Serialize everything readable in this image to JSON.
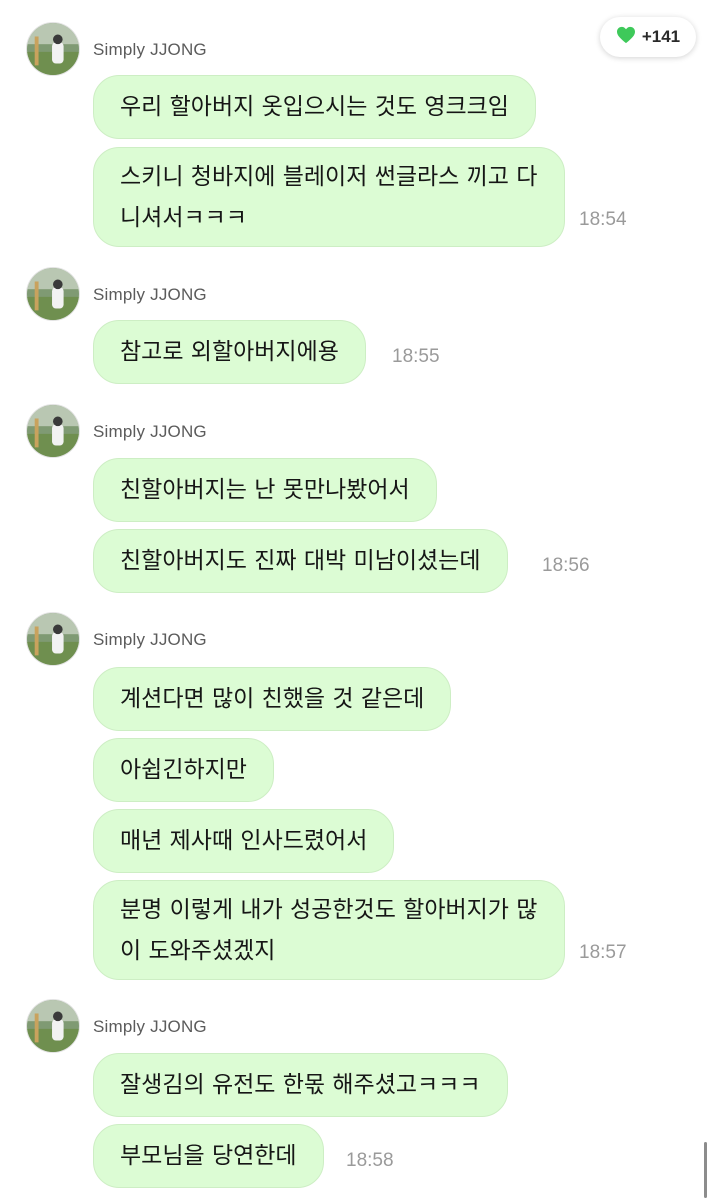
{
  "colors": {
    "bubble": "#dcfcd4",
    "heart": "#3ec95a",
    "timestamp": "#9a9a9a"
  },
  "reaction": {
    "icon": "heart-icon",
    "count": "+141"
  },
  "groups": [
    {
      "sender": "Simply JJONG",
      "messages": [
        "우리 할아버지 옷입으시는 것도 영크크임",
        "스키니 청바지에 블레이저 썬글라스 끼고 다니셔서ㅋㅋㅋ"
      ],
      "time": "18:54"
    },
    {
      "sender": "Simply JJONG",
      "messages": [
        "참고로 외할아버지에용"
      ],
      "time": "18:55"
    },
    {
      "sender": "Simply JJONG",
      "messages": [
        "친할아버지는 난 못만나봤어서",
        "친할아버지도 진짜 대박 미남이셨는데"
      ],
      "time": "18:56"
    },
    {
      "sender": "Simply JJONG",
      "messages": [
        "계션다면 많이 친했을 것 같은데",
        "아쉽긴하지만",
        "매년 제사때 인사드렸어서",
        "분명 이렇게 내가 성공한것도 할아버지가 많이 도와주셨겠지"
      ],
      "time": "18:57"
    },
    {
      "sender": "Simply JJONG",
      "messages": [
        "잘생김의 유전도 한몫 해주셨고ㅋㅋㅋ",
        "부모님을 당연한데"
      ],
      "time": "18:58"
    }
  ]
}
